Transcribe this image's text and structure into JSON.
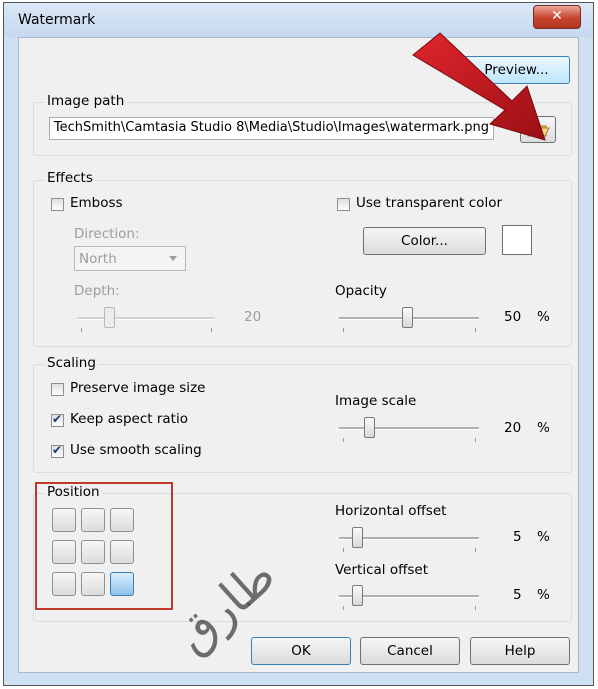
{
  "window": {
    "title": "Watermark",
    "close_glyph": "✕"
  },
  "preview_label": "Preview...",
  "image_path": {
    "group_label": "Image path",
    "value": "TechSmith\\Camtasia Studio 8\\Media\\Studio\\Images\\watermark.png",
    "browse_icon": "folder-open-icon"
  },
  "effects": {
    "group_label": "Effects",
    "emboss_label": "Emboss",
    "emboss_checked": false,
    "direction_label": "Direction:",
    "direction_value": "North",
    "depth_label": "Depth:",
    "depth_value": "20",
    "use_transparent_label": "Use transparent color",
    "use_transparent_checked": false,
    "color_button_label": "Color...",
    "opacity_label": "Opacity",
    "opacity_value": "50",
    "opacity_unit": "%"
  },
  "scaling": {
    "group_label": "Scaling",
    "preserve_label": "Preserve image size",
    "preserve_checked": false,
    "keep_aspect_label": "Keep aspect ratio",
    "keep_aspect_checked": true,
    "smooth_label": "Use smooth scaling",
    "smooth_checked": true,
    "image_scale_label": "Image scale",
    "image_scale_value": "20",
    "image_scale_unit": "%"
  },
  "position": {
    "group_label": "Position",
    "selected_cell": "bottom-right",
    "horizontal_label": "Horizontal offset",
    "horizontal_value": "5",
    "horizontal_unit": "%",
    "vertical_label": "Vertical offset",
    "vertical_value": "5",
    "vertical_unit": "%"
  },
  "buttons": {
    "ok": "OK",
    "cancel": "Cancel",
    "help": "Help"
  },
  "overlay": {
    "watermark_text": "طارق",
    "arrow_color": "#c8161d",
    "highlight_color": "#c0392b"
  }
}
